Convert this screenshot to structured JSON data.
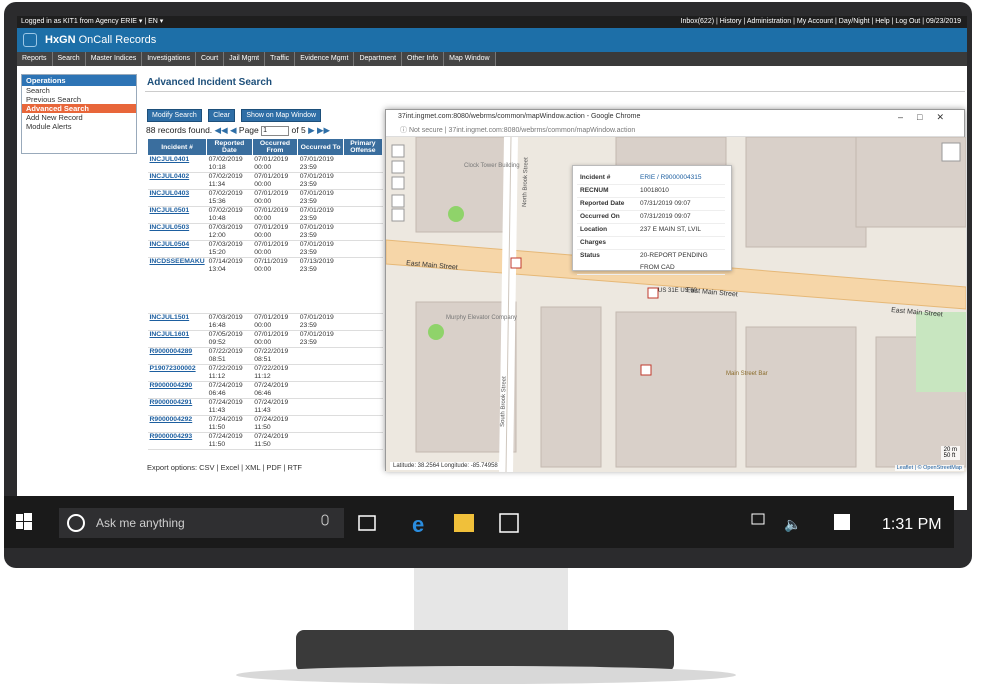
{
  "topbar": {
    "left": "Logged in as KIT1 from Agency ERIE ▾  |  EN ▾",
    "right": "Inbox(622)  |  History  |  Administration  |  My Account  |  Day/Night  |  Help  |  Log Out  |  09/23/2019"
  },
  "header": {
    "brand": "HxGN",
    "title": "OnCall Records"
  },
  "nav": [
    "Reports",
    "Search",
    "Master Indices",
    "Investigations",
    "Court",
    "Jail Mgmt",
    "Traffic",
    "Evidence Mgmt",
    "Department",
    "Other Info",
    "Map Window"
  ],
  "sidebar": {
    "heading": "Operations",
    "items": [
      "Search",
      "Previous Search",
      "Advanced Search",
      "Add New Record",
      "Module Alerts"
    ]
  },
  "main": {
    "title": "Advanced Incident Search",
    "buttons": [
      "Modify Search",
      "Clear",
      "Show on Map Window"
    ],
    "records_found": "88 records found.",
    "page_label": "Page",
    "page_value": "1",
    "page_of": "of 5",
    "columns": [
      "Incident #",
      "Reported Date",
      "Occurred From",
      "Occurred To",
      "Primary Offense"
    ],
    "rows": [
      [
        "INCJUL0401",
        "07/02/2019 10:18",
        "07/01/2019 00:00",
        "07/01/2019 23:59"
      ],
      [
        "INCJUL0402",
        "07/02/2019 11:34",
        "07/01/2019 00:00",
        "07/01/2019 23:59"
      ],
      [
        "INCJUL0403",
        "07/02/2019 15:36",
        "07/01/2019 00:00",
        "07/01/2019 23:59"
      ],
      [
        "INCJUL0501",
        "07/02/2019 10:48",
        "07/01/2019 00:00",
        "07/01/2019 23:59"
      ],
      [
        "INCJUL0503",
        "07/03/2019 12:00",
        "07/01/2019 00:00",
        "07/01/2019 23:59"
      ],
      [
        "INCJUL0504",
        "07/03/2019 15:20",
        "07/01/2019 00:00",
        "07/01/2019 23:59"
      ],
      [
        "INCDSSEEMAKU",
        "07/14/2019 13:04",
        "07/11/2019 00:00",
        "07/13/2019 23:59"
      ],
      [
        "INCJUL1501",
        "07/03/2019 16:48",
        "07/01/2019 00:00",
        "07/01/2019 23:59"
      ],
      [
        "INCJUL1601",
        "07/05/2019 09:52",
        "07/01/2019 00:00",
        "07/01/2019 23:59"
      ],
      [
        "R9000004289",
        "07/22/2019 08:51",
        "07/22/2019 08:51",
        ""
      ],
      [
        "P19072300002",
        "07/22/2019 11:12",
        "07/22/2019 11:12",
        ""
      ],
      [
        "R9000004290",
        "07/24/2019 06:46",
        "07/24/2019 06:46",
        ""
      ],
      [
        "R9000004291",
        "07/24/2019 11:43",
        "07/24/2019 11:43",
        ""
      ],
      [
        "R9000004292",
        "07/24/2019 11:50",
        "07/24/2019 11:50",
        ""
      ],
      [
        "R9000004293",
        "07/24/2019 11:50",
        "07/24/2019 11:50",
        ""
      ]
    ],
    "export_label": "Export options:",
    "export_items": [
      "CSV",
      "Excel",
      "XML",
      "PDF",
      "RTF"
    ]
  },
  "mapwin": {
    "title": "37int.ingmet.com:8080/webrms/common/mapWindow.action - Google Chrome",
    "not_secure": "Not secure",
    "url": "37int.ingmet.com:8080/webrms/common/mapWindow.action",
    "popup": [
      [
        "Incident #",
        "ERIE / R9000004315"
      ],
      [
        "RECNUM",
        "10018010"
      ],
      [
        "Reported Date",
        "07/31/2019 09:07"
      ],
      [
        "Occurred On",
        "07/31/2019 09:07"
      ],
      [
        "Location",
        "237 E MAIN ST, LVIL"
      ],
      [
        "Charges",
        ""
      ],
      [
        "Status",
        "20-REPORT PENDING FROM CAD"
      ]
    ],
    "streets": [
      "East Main Street",
      "East Main Street",
      "East Main Street",
      "North Brook Street",
      "South Brook Street",
      "US 31E US 60"
    ],
    "places": [
      "Clock Tower Building",
      "Murphy Elevator Company",
      "Main Street Bar"
    ],
    "latlon": "Latitude: 38.2564  Longitude: -85.74958",
    "scale": [
      "20 m",
      "50 ft"
    ],
    "attribution": "Leaflet | © OpenStreetMap"
  },
  "taskbar": {
    "search": "Ask me anything",
    "time": "1:31 PM"
  }
}
